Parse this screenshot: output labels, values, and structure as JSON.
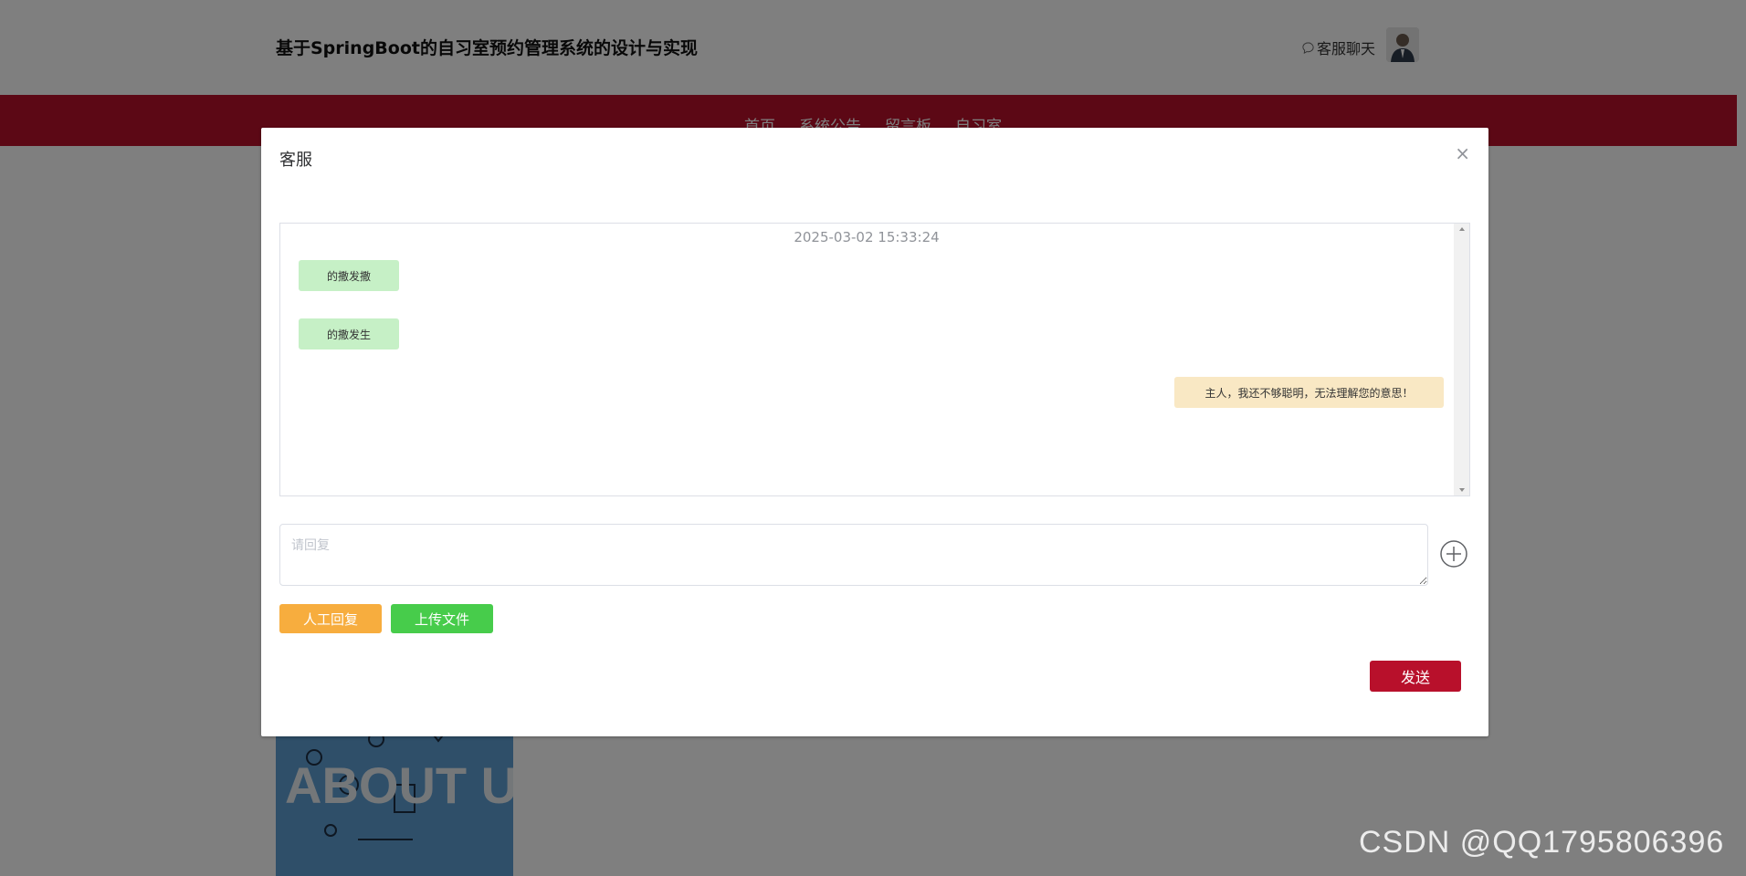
{
  "site": {
    "title": "基于SpringBoot的自习室预约管理系统的设计与实现",
    "chat_link": "客服聊天",
    "nav": [
      "首页",
      "系统公告",
      "留言板",
      "自习室"
    ],
    "about_image_text": "ABOUT US"
  },
  "dialog": {
    "title": "客服",
    "close": "×",
    "timestamp": "2025-03-02 15:33:24",
    "messages": [
      {
        "side": "user",
        "text": "的撒发撒"
      },
      {
        "side": "user",
        "text": "的撒发生"
      },
      {
        "side": "bot",
        "text": "主人，我还不够聪明，无法理解您的意思！"
      }
    ],
    "reply_placeholder": "请回复",
    "reply_value": "",
    "buttons": {
      "manual": "人工回复",
      "upload": "上传文件",
      "send": "发送"
    }
  },
  "watermark": "CSDN @QQ1795806396",
  "colors": {
    "primary": "#b8102b",
    "user_bubble": "#c6f0c6",
    "bot_bubble": "#f9e8c4",
    "manual_button": "#f7ad3e",
    "upload_button": "#47cc4b"
  },
  "icons": {
    "chat": "chat-bubble-icon",
    "close": "close-icon",
    "add": "plus-circle-icon"
  }
}
